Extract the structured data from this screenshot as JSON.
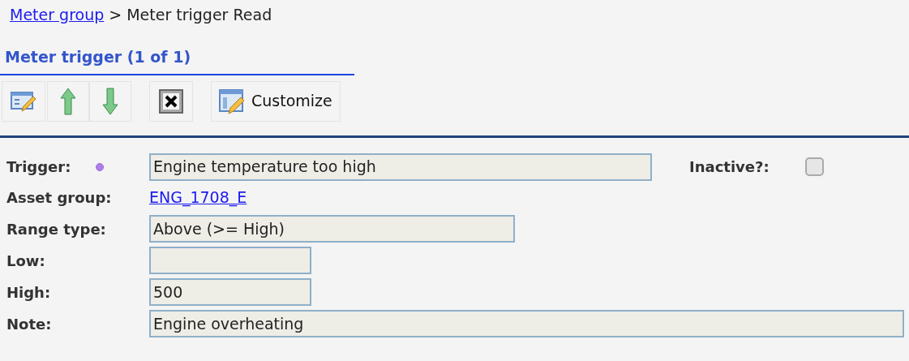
{
  "breadcrumb": {
    "link": "Meter group",
    "separator": ">",
    "current": "Meter trigger Read"
  },
  "section_title": "Meter trigger (1 of 1)",
  "toolbar": [
    {
      "kind": "edit"
    },
    {
      "kind": "up"
    },
    {
      "kind": "down"
    },
    {
      "kind": "delete"
    },
    {
      "kind": "customize",
      "label": "Customize"
    }
  ],
  "form": {
    "trigger": {
      "label": "Trigger:",
      "value": "Engine temperature too high"
    },
    "inactive": {
      "label": "Inactive?:",
      "checked": false
    },
    "rows": [
      {
        "kind": "link",
        "label": "Asset group:",
        "value": "ENG_1708_E"
      },
      {
        "kind": "field",
        "label": "Range type:",
        "value": "Above (>= High)"
      },
      {
        "kind": "field",
        "label": "Low:"
      },
      {
        "kind": "field",
        "label": "High:",
        "value": "500"
      },
      {
        "kind": "field",
        "label": "Note:",
        "value": "Engine overheating"
      }
    ]
  }
}
